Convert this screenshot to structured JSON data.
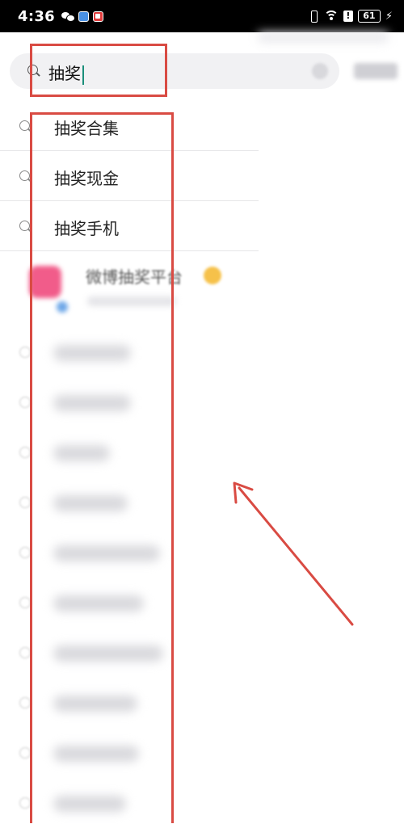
{
  "status_bar": {
    "time": "4:36",
    "alert_glyph": "!",
    "battery_level": "61",
    "charging_glyph": "⚡",
    "icons": [
      "wechat-icon",
      "blue-app-icon",
      "red-app-icon",
      "vibrate-icon",
      "wifi-icon",
      "alert-icon",
      "battery-icon",
      "charging-icon"
    ]
  },
  "search": {
    "query": "抽奖",
    "icon": "search-icon"
  },
  "suggestions": [
    {
      "label": "抽奖合集",
      "icon": "search-icon"
    },
    {
      "label": "抽奖现金",
      "icon": "search-icon"
    },
    {
      "label": "抽奖手机",
      "icon": "search-icon"
    }
  ],
  "promo": {
    "title": "微博抽奖平台",
    "icon": "gift-icon"
  },
  "blurred_history_count": 10,
  "colors": {
    "annotation": "#d94b43",
    "caret": "#1a8f7a",
    "search_bg": "#f1f1f3"
  }
}
